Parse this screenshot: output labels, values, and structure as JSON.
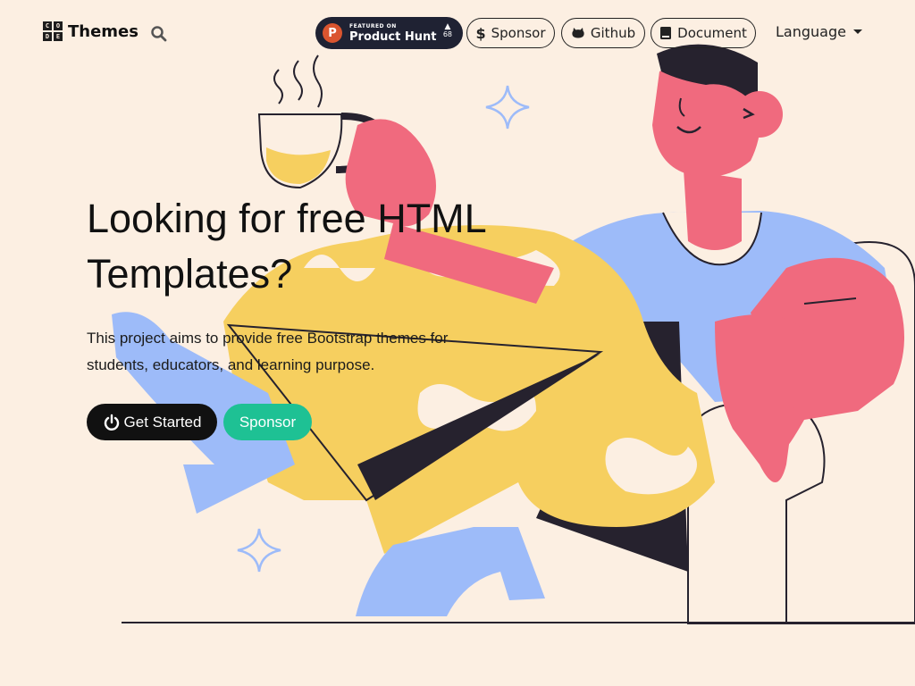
{
  "nav": {
    "brand_logo_letters": [
      "C",
      "O",
      "D",
      "E"
    ],
    "brand": "Themes",
    "search_icon": "search-icon",
    "product_hunt": {
      "featured_label": "FEATURED ON",
      "name": "Product Hunt",
      "upvotes": "68"
    },
    "sponsor": "Sponsor",
    "github": "Github",
    "document": "Document",
    "language": "Language"
  },
  "hero": {
    "title": "Looking for free HTML Templates?",
    "subtitle": "This project aims to provide free Bootstrap themes for students, educators, and learning purpose.",
    "get_started": "Get Started",
    "sponsor": "Sponsor"
  },
  "colors": {
    "background": "#fcefe2",
    "dark": "#111111",
    "sponsor_green": "#1ec194",
    "product_hunt_bg": "#1f2233",
    "product_hunt_orange": "#da552f",
    "illus_pink": "#f06a7e",
    "illus_yellow": "#f6cf5f",
    "illus_blue": "#9dbbf9"
  }
}
